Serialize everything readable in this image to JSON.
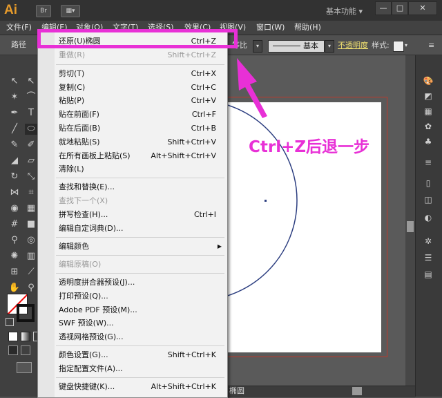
{
  "app": {
    "logo": "Ai",
    "bridge_label": "Br",
    "workspace": "基本功能",
    "win_buttons": [
      "—",
      "□",
      "✕"
    ]
  },
  "menubar": [
    "文件(F)",
    "编辑(E)",
    "对象(O)",
    "文字(T)",
    "选择(S)",
    "效果(C)",
    "视图(V)",
    "窗口(W)",
    "帮助(H)"
  ],
  "control_bar": {
    "path_label": "路径",
    "stroke_ratio": "等比",
    "stroke_style": "基本",
    "opacity_label": "不透明度",
    "style_label": "样式:"
  },
  "edit_menu": {
    "items": [
      {
        "label": "还原(U)椭圆",
        "shortcut": "Ctrl+Z",
        "disabled": false
      },
      {
        "label": "重做(R)",
        "shortcut": "Shift+Ctrl+Z",
        "disabled": true
      },
      {
        "label": "剪切(T)",
        "shortcut": "Ctrl+X",
        "disabled": false
      },
      {
        "label": "复制(C)",
        "shortcut": "Ctrl+C",
        "disabled": false
      },
      {
        "label": "粘贴(P)",
        "shortcut": "Ctrl+V",
        "disabled": false
      },
      {
        "label": "贴在前面(F)",
        "shortcut": "Ctrl+F",
        "disabled": false
      },
      {
        "label": "贴在后面(B)",
        "shortcut": "Ctrl+B",
        "disabled": false
      },
      {
        "label": "就地粘贴(S)",
        "shortcut": "Shift+Ctrl+V",
        "disabled": false
      },
      {
        "label": "在所有画板上粘贴(S)",
        "shortcut": "Alt+Shift+Ctrl+V",
        "disabled": false
      },
      {
        "label": "清除(L)",
        "shortcut": "",
        "disabled": false
      },
      {
        "label": "查找和替换(E)...",
        "shortcut": "",
        "disabled": false
      },
      {
        "label": "查找下一个(X)",
        "shortcut": "",
        "disabled": true
      },
      {
        "label": "拼写检查(H)...",
        "shortcut": "Ctrl+I",
        "disabled": false
      },
      {
        "label": "编辑自定词典(D)...",
        "shortcut": "",
        "disabled": false
      },
      {
        "label": "编辑颜色",
        "shortcut": "",
        "disabled": false
      },
      {
        "label": "编辑原稿(O)",
        "shortcut": "",
        "disabled": true
      },
      {
        "label": "透明度拼合器预设(J)...",
        "shortcut": "",
        "disabled": false
      },
      {
        "label": "打印预设(Q)...",
        "shortcut": "",
        "disabled": false
      },
      {
        "label": "Adobe PDF 预设(M)...",
        "shortcut": "",
        "disabled": false
      },
      {
        "label": "SWF 预设(W)...",
        "shortcut": "",
        "disabled": false
      },
      {
        "label": "透视网格预设(G)...",
        "shortcut": "",
        "disabled": false
      },
      {
        "label": "颜色设置(G)...",
        "shortcut": "Shift+Ctrl+K",
        "disabled": false
      },
      {
        "label": "指定配置文件(A)...",
        "shortcut": "",
        "disabled": false
      },
      {
        "label": "键盘快捷键(K)...",
        "shortcut": "Alt+Shift+Ctrl+K",
        "disabled": false
      }
    ]
  },
  "annotation": {
    "text": "Ctrl+Z后退一步",
    "color": "#e830d6"
  },
  "status": {
    "object_label": "椭圆"
  }
}
